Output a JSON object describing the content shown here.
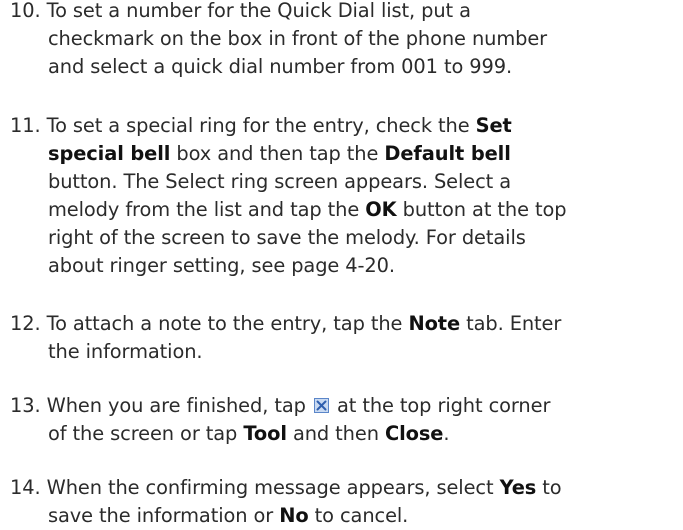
{
  "steps": [
    {
      "number": "10.",
      "lines": [
        [
          {
            "t": "To set a number for the Quick Dial list, put a"
          }
        ],
        [
          {
            "t": "checkmark on the box in front of the phone number"
          }
        ],
        [
          {
            "t": "and select a quick dial number from 001 to 999."
          }
        ]
      ]
    },
    {
      "number": "11.",
      "lines": [
        [
          {
            "t": "To set a special ring for the entry, check the "
          },
          {
            "t": "Set",
            "b": true
          }
        ],
        [
          {
            "t": "special bell",
            "b": true
          },
          {
            "t": " box and then tap the "
          },
          {
            "t": "Default bell",
            "b": true
          }
        ],
        [
          {
            "t": "button. The Select ring screen appears. Select a"
          }
        ],
        [
          {
            "t": "melody from the list and tap the "
          },
          {
            "t": "OK",
            "b": true
          },
          {
            "t": " button at the top"
          }
        ],
        [
          {
            "t": "right of the screen to save the melody. For details"
          }
        ],
        [
          {
            "t": "about ringer setting, see page 4-20."
          }
        ]
      ]
    },
    {
      "number": "12.",
      "lines": [
        [
          {
            "t": "To attach a note to the entry, tap the "
          },
          {
            "t": "Note",
            "b": true
          },
          {
            "t": " tab. Enter"
          }
        ],
        [
          {
            "t": "the information."
          }
        ]
      ]
    },
    {
      "number": "13.",
      "lines": [
        [
          {
            "t": "When you are finished, tap "
          },
          {
            "icon": "close-icon"
          },
          {
            "t": " at the top right corner"
          }
        ],
        [
          {
            "t": "of the screen or tap "
          },
          {
            "t": "Tool",
            "b": true
          },
          {
            "t": " and then "
          },
          {
            "t": "Close",
            "b": true
          },
          {
            "t": "."
          }
        ]
      ]
    },
    {
      "number": "14.",
      "lines": [
        [
          {
            "t": "When the confirming message appears, select "
          },
          {
            "t": "Yes",
            "b": true
          },
          {
            "t": " to"
          }
        ],
        [
          {
            "t": "save the information or "
          },
          {
            "t": "No",
            "b": true
          },
          {
            "t": " to cancel."
          }
        ]
      ]
    }
  ],
  "colors": {
    "text": "#2b2b2b",
    "icon_fill": "#c9daf2",
    "icon_border": "#5b86c9",
    "icon_x": "#2f5fae"
  }
}
